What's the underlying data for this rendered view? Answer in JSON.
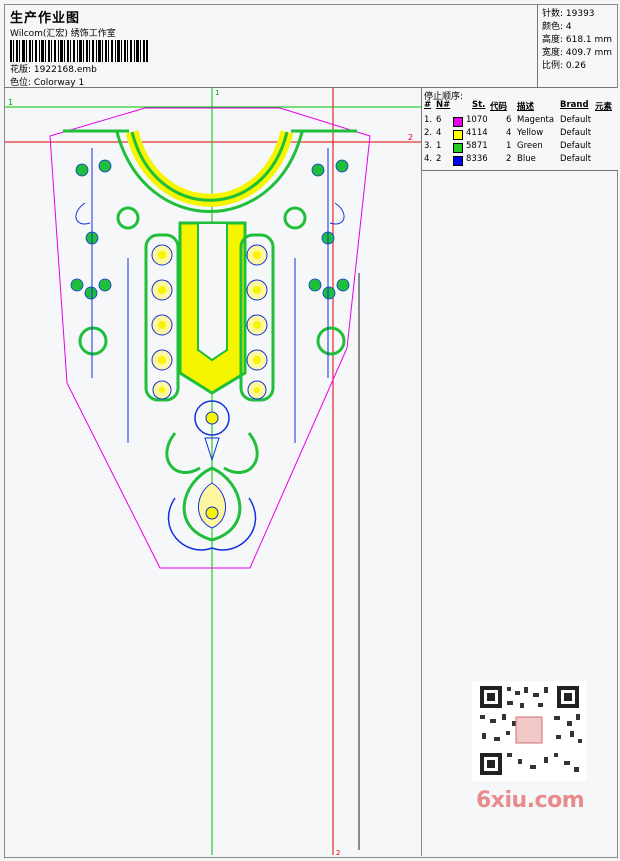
{
  "header": {
    "title": "生产作业图",
    "company": "Wilcom(汇宏) 绣饰工作室",
    "design_label": "花版:",
    "design_value": "1922168.emb",
    "colorway_label": "色位:",
    "colorway_value": "Colorway 1"
  },
  "stats": {
    "stitches": "针数: 19393",
    "colors": "颜色: 4",
    "height": "高度: 618.1 mm",
    "width": "宽度: 409.7 mm",
    "scale": "比例: 0.26"
  },
  "stop_sequence": {
    "title": "停止顺序:",
    "headers": [
      "#",
      "N#",
      "St.",
      "代码",
      "描述",
      "Brand",
      "元素"
    ],
    "rows": [
      {
        "idx": "1.",
        "n": "6",
        "color": "#e800e8",
        "st": "1070",
        "code": "6",
        "desc": "Magenta",
        "brand": "Default"
      },
      {
        "idx": "2.",
        "n": "4",
        "color": "#ffff00",
        "st": "4114",
        "code": "4",
        "desc": "Yellow",
        "brand": "Default"
      },
      {
        "idx": "3.",
        "n": "1",
        "color": "#22cc22",
        "st": "5871",
        "code": "1",
        "desc": "Green",
        "brand": "Default"
      },
      {
        "idx": "4.",
        "n": "2",
        "color": "#0000ee",
        "st": "8336",
        "code": "2",
        "desc": "Blue",
        "brand": "Default"
      }
    ]
  },
  "guides": {
    "h1": "1",
    "h2": "2",
    "v1": "1",
    "v2": "2"
  },
  "watermark": "6xiu.com",
  "colors": {
    "magenta": "#e800e8",
    "yellow": "#f5f500",
    "green": "#1fbf3a",
    "blue": "#1030e0",
    "guide_green": "#00c000",
    "guide_red": "#e00000"
  }
}
